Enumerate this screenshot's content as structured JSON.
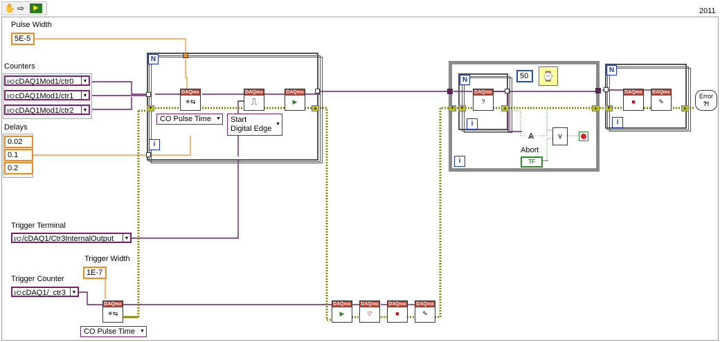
{
  "toolbar": {
    "run_icon": "run-arrow-icon",
    "version": "2011"
  },
  "controls": {
    "pulse_width": {
      "label": "Pulse Width",
      "value": "5E-5"
    },
    "counters": {
      "label": "Counters",
      "items": [
        "cDAQ1Mod1/ctr0",
        "cDAQ1Mod1/ctr1",
        "cDAQ1Mod1/ctr2"
      ]
    },
    "delays": {
      "label": "Delays",
      "items": [
        "0.02",
        "0.1",
        "0.2"
      ]
    },
    "trigger_terminal": {
      "label": "Trigger Terminal",
      "value": "/cDAQ1/Ctr3InternalOutput"
    },
    "trigger_width": {
      "label": "Trigger Width",
      "value": "1E-7"
    },
    "trigger_counter": {
      "label": "Trigger Counter",
      "value": "cDAQ1/_ctr3"
    }
  },
  "loops": {
    "n_label": "N",
    "i_label": "i",
    "wait_ms": "50"
  },
  "nodes": {
    "daqmx_header": "DAQmx",
    "co_pulse_time": "CO Pulse Time",
    "start_digital_edge_line1": "Start",
    "start_digital_edge_line2": "Digital Edge",
    "abort_label": "Abort",
    "abort_const": "TF",
    "error_label": "Error",
    "or_label": "v"
  },
  "colors": {
    "refnum": "#6a1b6a",
    "numeric": "#f08a1c",
    "error": "#c8c800",
    "boolean": "#2a8a2a",
    "structure": "#808080"
  }
}
